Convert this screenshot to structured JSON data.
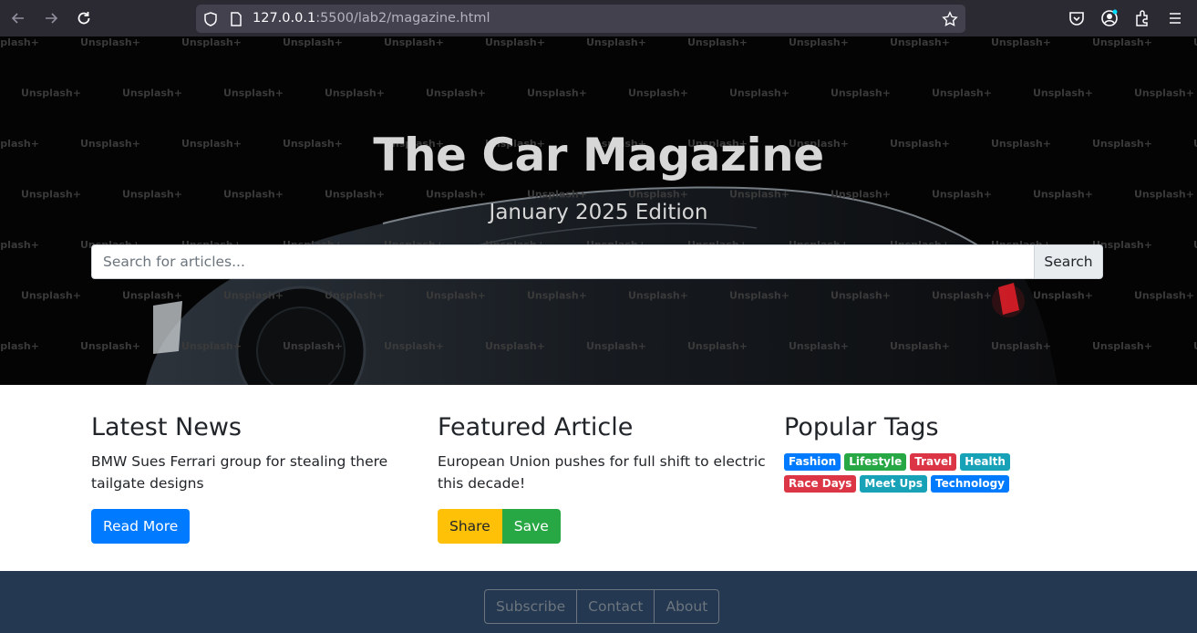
{
  "browser": {
    "url_host": "127.0.0.1",
    "url_rest": ":5500/lab2/magazine.html"
  },
  "hero": {
    "title": "The Car Magazine",
    "subtitle": "January 2025 Edition",
    "watermark_text": "Unsplash+",
    "search_placeholder": "Search for articles...",
    "search_button": "Search"
  },
  "latest": {
    "heading": "Latest News",
    "text": "BMW Sues Ferrari group for stealing there tailgate designs",
    "button": "Read More"
  },
  "featured": {
    "heading": "Featured Article",
    "text": "European Union pushes for full shift to electric this decade!",
    "share_button": "Share",
    "save_button": "Save"
  },
  "tags": {
    "heading": "Popular Tags",
    "items": [
      {
        "label": "Fashion",
        "color": "#007bff"
      },
      {
        "label": "Lifestyle",
        "color": "#28a745"
      },
      {
        "label": "Travel",
        "color": "#dc3545"
      },
      {
        "label": "Health",
        "color": "#17a2b8"
      },
      {
        "label": "Race Days",
        "color": "#dc3545"
      },
      {
        "label": "Meet Ups",
        "color": "#17a2b8"
      },
      {
        "label": "Technology",
        "color": "#007bff"
      }
    ]
  },
  "footer": {
    "buttons": [
      "Subscribe",
      "Contact",
      "About"
    ]
  }
}
